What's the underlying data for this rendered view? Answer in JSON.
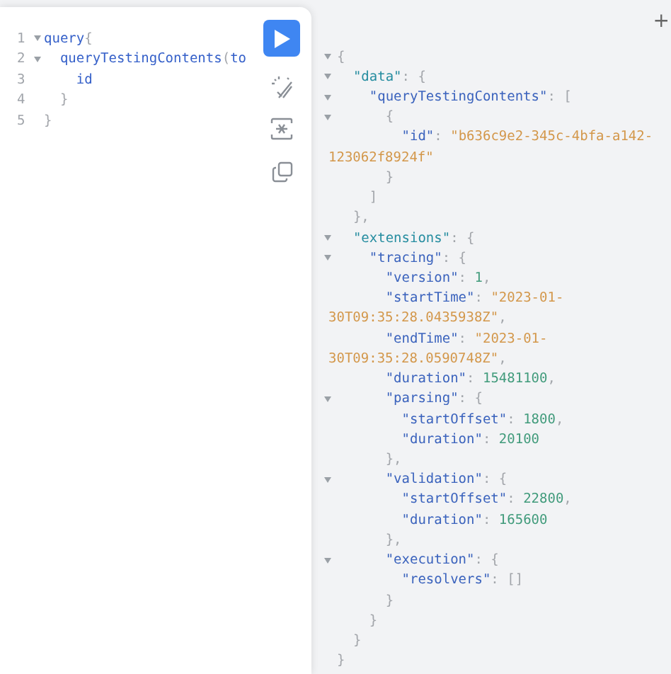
{
  "editor": {
    "lines": [
      {
        "number": "1",
        "fold": true,
        "tokens": [
          {
            "kind": "field",
            "text": "query"
          },
          {
            "kind": "punct",
            "text": "{"
          }
        ]
      },
      {
        "number": "2",
        "fold": true,
        "tokens": [
          {
            "kind": "field",
            "text": "  queryTestingContents"
          },
          {
            "kind": "punct",
            "text": "("
          },
          {
            "kind": "field",
            "text": "to"
          }
        ]
      },
      {
        "number": "3",
        "fold": false,
        "tokens": [
          {
            "kind": "field",
            "text": "    id"
          }
        ]
      },
      {
        "number": "4",
        "fold": false,
        "tokens": [
          {
            "kind": "punct",
            "text": "  }"
          }
        ]
      },
      {
        "number": "5",
        "fold": false,
        "tokens": [
          {
            "kind": "punct",
            "text": "}"
          }
        ]
      }
    ]
  },
  "toolbar": [
    {
      "kind": "run"
    },
    {
      "kind": "prettify"
    },
    {
      "kind": "merge"
    },
    {
      "kind": "copy"
    }
  ],
  "result": {
    "add_button": "+",
    "lines": [
      {
        "kind": "line",
        "fold": true,
        "tokens": [
          {
            "kind": "punct",
            "text": "{"
          }
        ]
      },
      {
        "kind": "line",
        "fold": true,
        "tokens": [
          {
            "kind": "root_key",
            "text": "  \"data\""
          },
          {
            "kind": "punct",
            "text": ": {"
          }
        ]
      },
      {
        "kind": "line",
        "fold": true,
        "tokens": [
          {
            "kind": "key",
            "text": "    \"queryTestingContents\""
          },
          {
            "kind": "punct",
            "text": ": ["
          }
        ]
      },
      {
        "kind": "line",
        "fold": true,
        "tokens": [
          {
            "kind": "punct",
            "text": "      {"
          }
        ]
      },
      {
        "kind": "line",
        "fold": false,
        "tokens": [
          {
            "kind": "key",
            "text": "        \"id\""
          },
          {
            "kind": "punct",
            "text": ": "
          },
          {
            "kind": "string",
            "text": "\"b636c9e2-345c-4bfa-a142-"
          }
        ]
      },
      {
        "kind": "continuation",
        "tokens": [
          {
            "kind": "string",
            "text": "123062f8924f\""
          }
        ]
      },
      {
        "kind": "line",
        "fold": false,
        "tokens": [
          {
            "kind": "punct",
            "text": "      }"
          }
        ]
      },
      {
        "kind": "line",
        "fold": false,
        "tokens": [
          {
            "kind": "punct",
            "text": "    ]"
          }
        ]
      },
      {
        "kind": "line",
        "fold": false,
        "tokens": [
          {
            "kind": "punct",
            "text": "  },"
          }
        ]
      },
      {
        "kind": "line",
        "fold": true,
        "tokens": [
          {
            "kind": "root_key",
            "text": "  \"extensions\""
          },
          {
            "kind": "punct",
            "text": ": {"
          }
        ]
      },
      {
        "kind": "line",
        "fold": true,
        "tokens": [
          {
            "kind": "key",
            "text": "    \"tracing\""
          },
          {
            "kind": "punct",
            "text": ": {"
          }
        ]
      },
      {
        "kind": "line",
        "fold": false,
        "tokens": [
          {
            "kind": "key",
            "text": "      \"version\""
          },
          {
            "kind": "punct",
            "text": ": "
          },
          {
            "kind": "number",
            "text": "1"
          },
          {
            "kind": "punct",
            "text": ","
          }
        ]
      },
      {
        "kind": "line",
        "fold": false,
        "tokens": [
          {
            "kind": "key",
            "text": "      \"startTime\""
          },
          {
            "kind": "punct",
            "text": ": "
          },
          {
            "kind": "string",
            "text": "\"2023-01-"
          }
        ]
      },
      {
        "kind": "continuation",
        "tokens": [
          {
            "kind": "string",
            "text": "30T09:35:28.0435938Z\""
          },
          {
            "kind": "punct",
            "text": ","
          }
        ]
      },
      {
        "kind": "line",
        "fold": false,
        "tokens": [
          {
            "kind": "key",
            "text": "      \"endTime\""
          },
          {
            "kind": "punct",
            "text": ": "
          },
          {
            "kind": "string",
            "text": "\"2023-01-"
          }
        ]
      },
      {
        "kind": "continuation",
        "tokens": [
          {
            "kind": "string",
            "text": "30T09:35:28.0590748Z\""
          },
          {
            "kind": "punct",
            "text": ","
          }
        ]
      },
      {
        "kind": "line",
        "fold": false,
        "tokens": [
          {
            "kind": "key",
            "text": "      \"duration\""
          },
          {
            "kind": "punct",
            "text": ": "
          },
          {
            "kind": "number",
            "text": "15481100"
          },
          {
            "kind": "punct",
            "text": ","
          }
        ]
      },
      {
        "kind": "line",
        "fold": true,
        "tokens": [
          {
            "kind": "key",
            "text": "      \"parsing\""
          },
          {
            "kind": "punct",
            "text": ": {"
          }
        ]
      },
      {
        "kind": "line",
        "fold": false,
        "tokens": [
          {
            "kind": "key",
            "text": "        \"startOffset\""
          },
          {
            "kind": "punct",
            "text": ": "
          },
          {
            "kind": "number",
            "text": "1800"
          },
          {
            "kind": "punct",
            "text": ","
          }
        ]
      },
      {
        "kind": "line",
        "fold": false,
        "tokens": [
          {
            "kind": "key",
            "text": "        \"duration\""
          },
          {
            "kind": "punct",
            "text": ": "
          },
          {
            "kind": "number",
            "text": "20100"
          }
        ]
      },
      {
        "kind": "line",
        "fold": false,
        "tokens": [
          {
            "kind": "punct",
            "text": "      },"
          }
        ]
      },
      {
        "kind": "line",
        "fold": true,
        "tokens": [
          {
            "kind": "key",
            "text": "      \"validation\""
          },
          {
            "kind": "punct",
            "text": ": {"
          }
        ]
      },
      {
        "kind": "line",
        "fold": false,
        "tokens": [
          {
            "kind": "key",
            "text": "        \"startOffset\""
          },
          {
            "kind": "punct",
            "text": ": "
          },
          {
            "kind": "number",
            "text": "22800"
          },
          {
            "kind": "punct",
            "text": ","
          }
        ]
      },
      {
        "kind": "line",
        "fold": false,
        "tokens": [
          {
            "kind": "key",
            "text": "        \"duration\""
          },
          {
            "kind": "punct",
            "text": ": "
          },
          {
            "kind": "number",
            "text": "165600"
          }
        ]
      },
      {
        "kind": "line",
        "fold": false,
        "tokens": [
          {
            "kind": "punct",
            "text": "      },"
          }
        ]
      },
      {
        "kind": "line",
        "fold": true,
        "tokens": [
          {
            "kind": "key",
            "text": "      \"execution\""
          },
          {
            "kind": "punct",
            "text": ": {"
          }
        ]
      },
      {
        "kind": "line",
        "fold": false,
        "tokens": [
          {
            "kind": "key",
            "text": "        \"resolvers\""
          },
          {
            "kind": "punct",
            "text": ": []"
          }
        ]
      },
      {
        "kind": "line",
        "fold": false,
        "tokens": [
          {
            "kind": "punct",
            "text": "      }"
          }
        ]
      },
      {
        "kind": "line",
        "fold": false,
        "tokens": [
          {
            "kind": "punct",
            "text": "    }"
          }
        ]
      },
      {
        "kind": "line",
        "fold": false,
        "tokens": [
          {
            "kind": "punct",
            "text": "  }"
          }
        ]
      },
      {
        "kind": "line",
        "fold": false,
        "tokens": [
          {
            "kind": "punct",
            "text": "}"
          }
        ]
      }
    ]
  }
}
